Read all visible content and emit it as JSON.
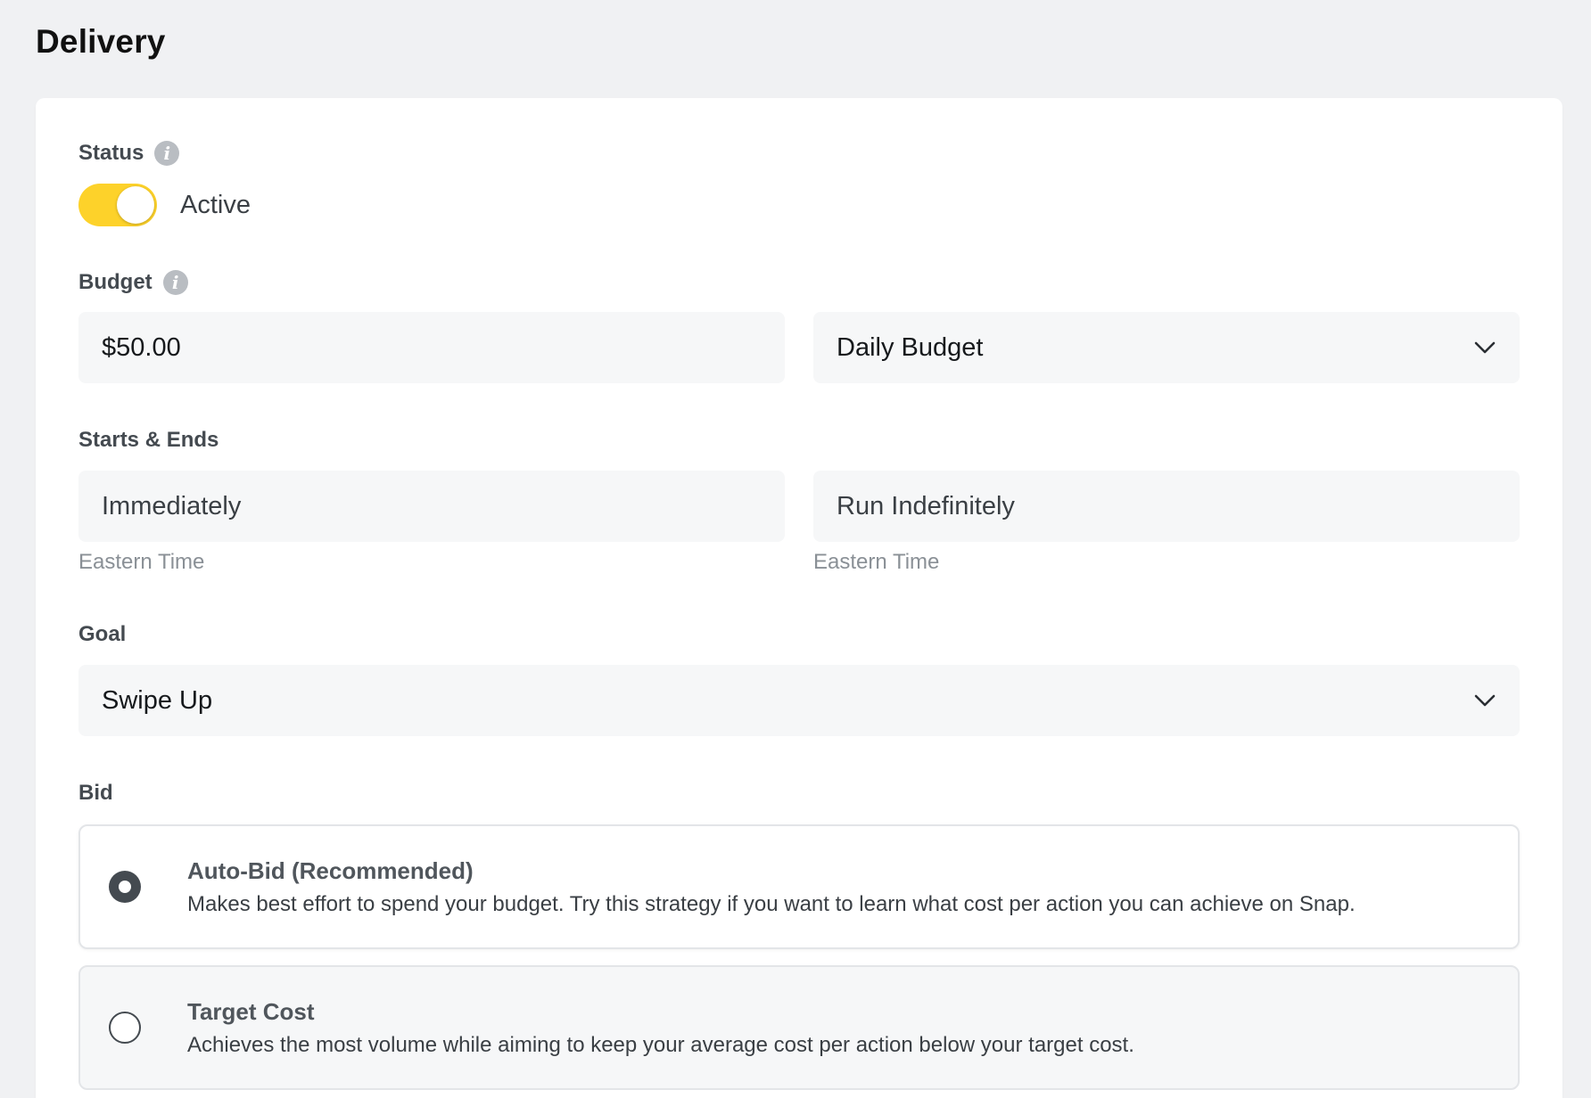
{
  "page": {
    "title": "Delivery"
  },
  "status": {
    "label": "Status",
    "toggle_state": "Active",
    "toggle_on": true,
    "toggle_color": "#fdd22a"
  },
  "budget": {
    "label": "Budget",
    "amount_value": "$50.00",
    "type_selected": "Daily Budget"
  },
  "schedule": {
    "label": "Starts & Ends",
    "start_value": "Immediately",
    "end_value": "Run Indefinitely",
    "start_timezone": "Eastern Time",
    "end_timezone": "Eastern Time"
  },
  "goal": {
    "label": "Goal",
    "selected": "Swipe Up"
  },
  "bid": {
    "label": "Bid",
    "options": [
      {
        "title": "Auto-Bid (Recommended)",
        "description": "Makes best effort to spend your budget. Try this strategy if you want to learn what cost per action you can achieve on Snap.",
        "selected": true
      },
      {
        "title": "Target Cost",
        "description": "Achieves the most volume while aiming to keep your average cost per action below your target cost.",
        "selected": false
      }
    ]
  },
  "icons": {
    "info": "info-icon",
    "dropdown": "chevron-down-icon"
  }
}
